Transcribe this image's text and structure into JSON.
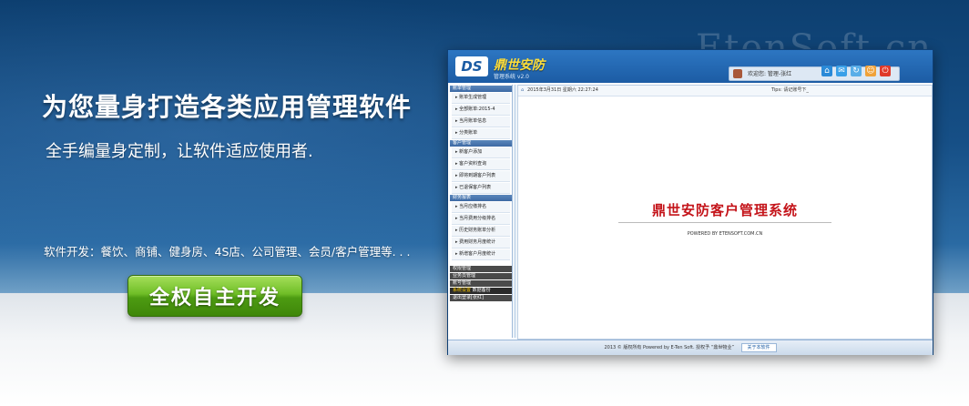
{
  "watermark": "EtenSoft.cn",
  "headline": "为您量身打造各类应用管理软件",
  "subline": "全手编量身定制，让软件适应使用者.",
  "bizline": "软件开发：餐饮、商铺、健身房、4S店、公司管理、会员/客户管理等. . .",
  "cta_label": "全权自主开发",
  "app": {
    "logo_mark": "DS",
    "logo_name": "鼎世安防",
    "logo_sub": "管理系统 v2.0",
    "user_text": "欢迎您: 管理-张红",
    "sidebar": {
      "groups": [
        {
          "title": "账单管理",
          "items": [
            "账单生成管理",
            "全部账单:2015-4",
            "当月账单信息",
            "分类账单"
          ]
        },
        {
          "title": "客户管理",
          "items": [
            "新客户添加",
            "客户资料查询",
            "即将到期客户列表",
            "已退保客户列表"
          ]
        },
        {
          "title": "财务报表",
          "items": [
            "当月应缴排名",
            "当月费用分级排名",
            "历史财务账单分析",
            "费用财务月度统计",
            "新增客户月度统计"
          ]
        }
      ],
      "bottom": [
        "权限管理",
        "业务员管理",
        "账号管理"
      ],
      "bottom_highlight": "系统设置",
      "bottom_highlight_extra": "数据备份",
      "logout": "退出登录[张红]"
    },
    "content": {
      "crumb": "2015年3月31日 星期六 22:27:24",
      "tips": "Tips: 请记账号下_",
      "title": "鼎世安防客户管理系统",
      "powered": "POWERED BY ETENSOFT.COM.CN"
    },
    "footer": {
      "text": "2013 © 版权所有 Powered by E-Ten Soft.  授权予 “鼎世物业”",
      "link": "关于本软件"
    }
  }
}
